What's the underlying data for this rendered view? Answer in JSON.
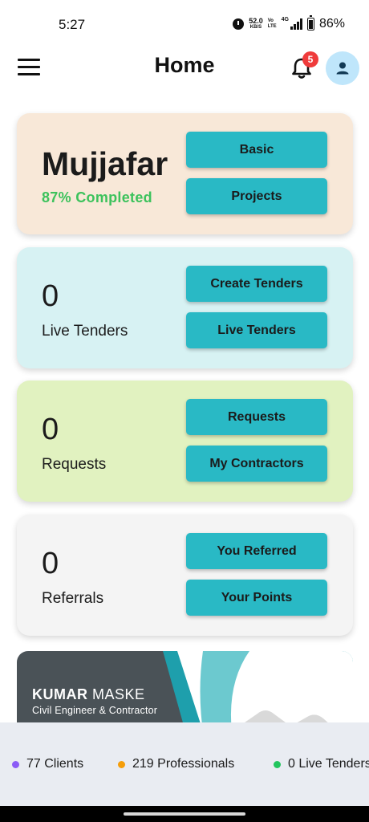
{
  "status_bar": {
    "time": "5:27",
    "net_speed": "52.0",
    "net_speed_unit": "KB/S",
    "volte_line1": "Vo",
    "volte_line2": "LTE",
    "network_type": "4G",
    "battery": "86%",
    "icons": [
      "alarm-icon",
      "signal-icon",
      "battery-icon"
    ]
  },
  "header": {
    "title": "Home",
    "notification_count": "5",
    "icons": [
      "menu-icon",
      "bell-icon",
      "user-icon"
    ]
  },
  "profile_card": {
    "name": "Mujjafar",
    "completion": "87% Completed",
    "buttons": [
      "Basic",
      "Projects"
    ],
    "background": "#f8e8d8"
  },
  "tenders_card": {
    "count": "0",
    "label": "Live Tenders",
    "buttons": [
      "Create Tenders",
      "Live Tenders"
    ],
    "background": "#d7f2f3"
  },
  "requests_card": {
    "count": "0",
    "label": "Requests",
    "buttons": [
      "Requests",
      "My Contractors"
    ],
    "background": "#e1f2c0"
  },
  "referrals_card": {
    "count": "0",
    "label": "Referrals",
    "buttons": [
      "You Referred",
      "Your Points"
    ],
    "background": "#f4f4f4"
  },
  "banner": {
    "name_bold": "KUMAR",
    "name_rest": " MASKE",
    "subtitle": "Civil Engineer & Contractor"
  },
  "stats": [
    {
      "text": "77 Clients",
      "dot_color": "#8b5cf6"
    },
    {
      "text": "219 Professionals",
      "dot_color": "#f59e0b"
    },
    {
      "text": "0 Live Tenders",
      "dot_color": "#22c55e"
    }
  ],
  "colors": {
    "accent_button": "#29b9c5",
    "completion_green": "#3cc25c",
    "badge_red": "#ef3b3b",
    "avatar_bg": "#bfe6fb"
  }
}
